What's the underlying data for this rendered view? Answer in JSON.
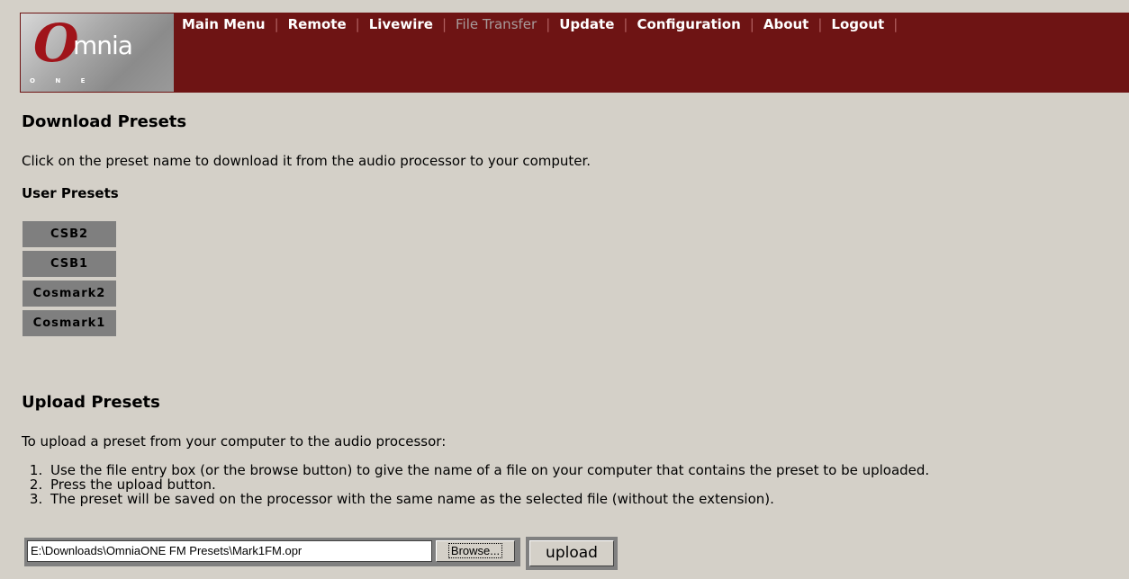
{
  "header": {
    "logo": {
      "o": "O",
      "mnia": "mnia",
      "one": "O N E"
    },
    "nav": [
      {
        "label": "Main Menu",
        "active": false
      },
      {
        "label": "Remote",
        "active": false
      },
      {
        "label": "Livewire",
        "active": false
      },
      {
        "label": "File Transfer",
        "active": true
      },
      {
        "label": "Update",
        "active": false
      },
      {
        "label": "Configuration",
        "active": false
      },
      {
        "label": "About",
        "active": false
      },
      {
        "label": "Logout",
        "active": false
      }
    ],
    "separator": "|",
    "colors": {
      "header_bg": "#6e1414",
      "page_bg": "#d4d0c8",
      "active_nav": "#a89c9c"
    }
  },
  "download": {
    "title": "Download Presets",
    "description": "Click on the preset name to download it from the audio processor to your computer.",
    "user_presets_label": "User Presets",
    "presets": [
      "CSB2",
      "CSB1",
      "Cosmark2",
      "Cosmark1"
    ]
  },
  "upload": {
    "title": "Upload Presets",
    "description": "To upload a preset from your computer to the audio processor:",
    "steps": [
      "Use the file entry box (or the browse button) to give the name of a file on your computer that contains the preset to be uploaded.",
      "Press the upload button.",
      "The preset will be saved on the processor with the same name as the selected file (without the extension)."
    ],
    "file_path": "E:\\Downloads\\OmniaONE FM Presets\\Mark1FM.opr",
    "browse_label": "Browse...",
    "upload_label": "upload"
  }
}
